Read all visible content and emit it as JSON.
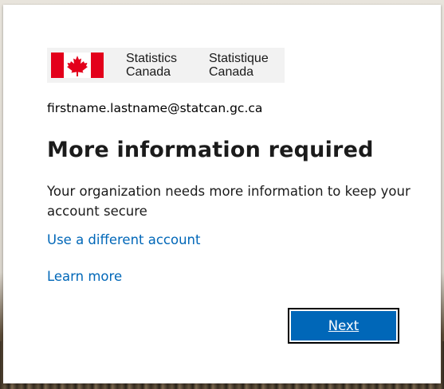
{
  "logo": {
    "name_en_line1": "Statistics",
    "name_en_line2": "Canada",
    "name_fr_line1": "Statistique",
    "name_fr_line2": "Canada",
    "flag_icon": "canada-flag-icon",
    "colors": {
      "flag_red": "#e3001b",
      "flag_white": "#ffffff",
      "logo_bg": "#f2f2f2"
    }
  },
  "account": {
    "email": "firstname.lastname@statcan.gc.ca"
  },
  "main": {
    "title": "More information required",
    "description": "Your organization needs more information to keep your account secure",
    "use_different_account_label": "Use a different account",
    "learn_more_label": "Learn more"
  },
  "actions": {
    "next_label": "Next"
  },
  "colors": {
    "accent": "#0067b8",
    "link": "#0067b8",
    "text": "#1b1b1b",
    "card_bg": "#ffffff"
  }
}
